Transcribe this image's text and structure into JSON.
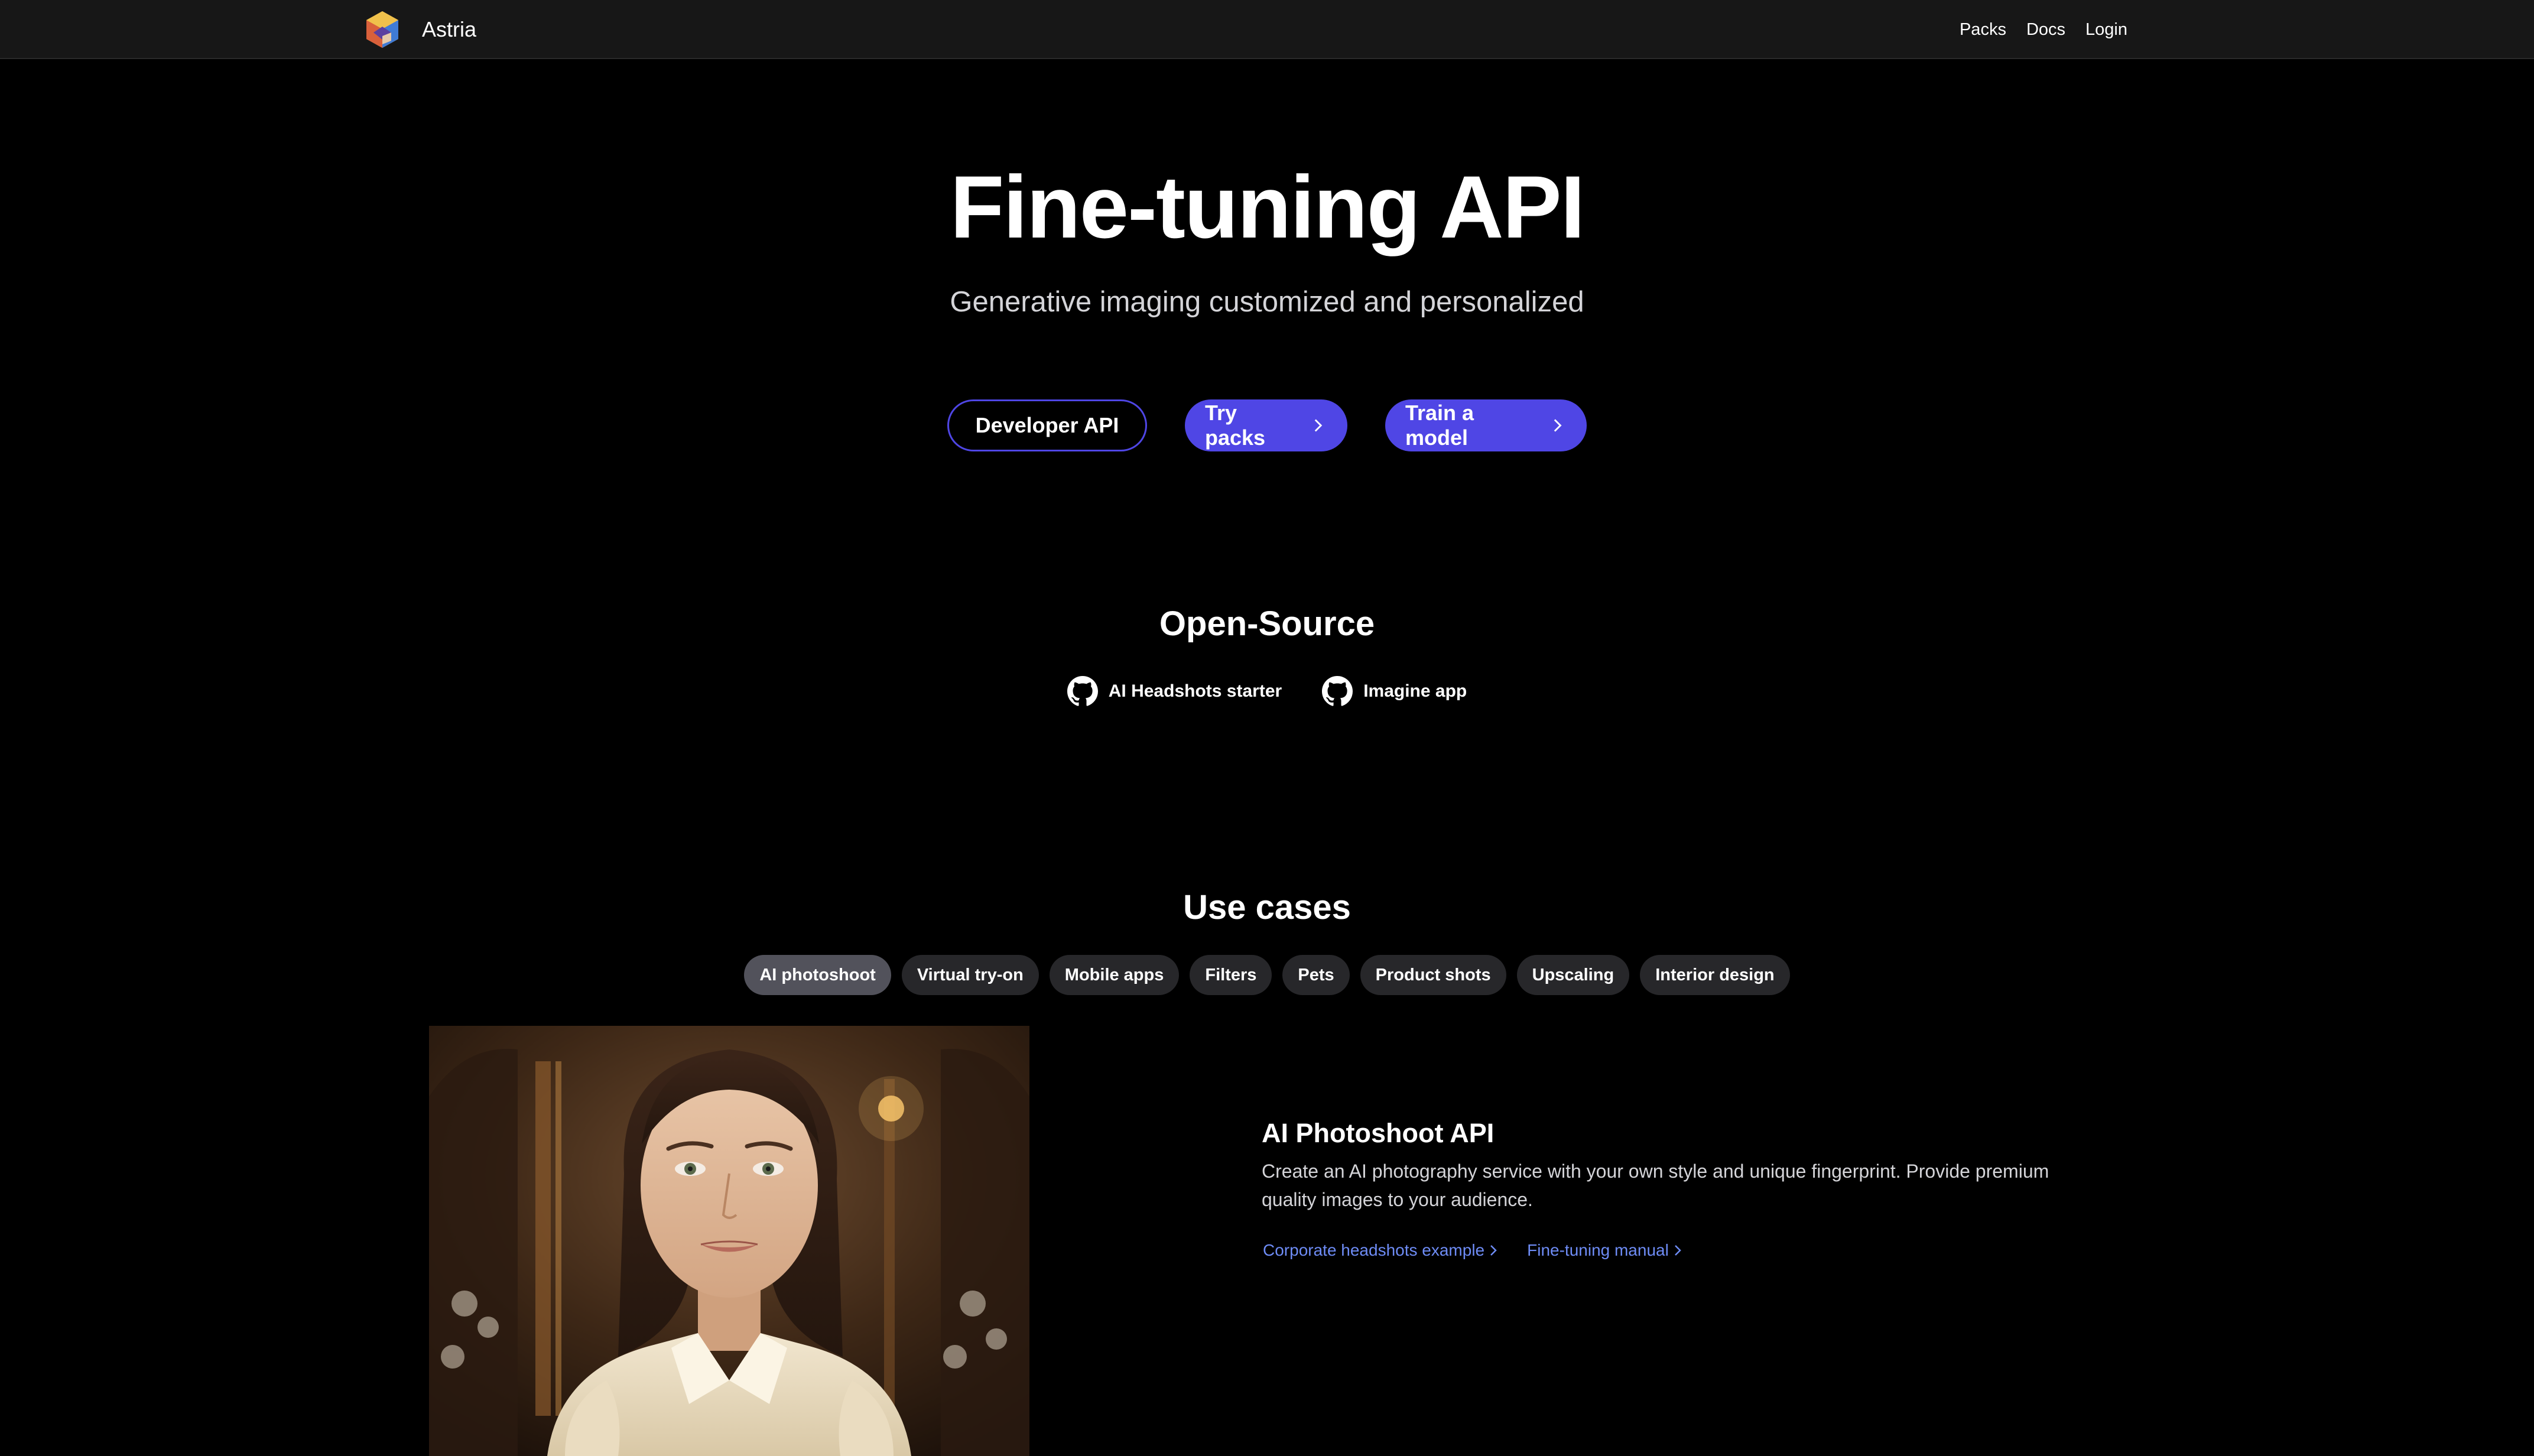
{
  "colors": {
    "accent": "#4f46e5",
    "link": "#6e8cf6",
    "navbar_bg": "#171717",
    "tab_bg": "#27272a",
    "tab_active_bg": "#52525b"
  },
  "navbar": {
    "brand": "Astria",
    "logo_icon": "astria-logo-icon",
    "links": [
      "Packs",
      "Docs",
      "Login"
    ]
  },
  "hero": {
    "title": "Fine-tuning API",
    "subtitle": "Generative imaging customized and personalized",
    "buttons": {
      "developer_api": "Developer API",
      "try_packs": "Try packs",
      "train_model": "Train a model"
    }
  },
  "open_source": {
    "title": "Open-Source",
    "links": [
      {
        "label": "AI Headshots starter",
        "icon": "github-icon"
      },
      {
        "label": "Imagine app",
        "icon": "github-icon"
      }
    ]
  },
  "use_cases": {
    "title": "Use cases",
    "tabs": [
      "AI photoshoot",
      "Virtual try-on",
      "Mobile apps",
      "Filters",
      "Pets",
      "Product shots",
      "Upscaling",
      "Interior design"
    ],
    "active_tab": "AI photoshoot",
    "active": {
      "heading": "AI Photoshoot API",
      "description": "Create an AI photography service with your own style and unique fingerprint. Provide premium quality images to your audience.",
      "links": [
        "Corporate headshots example",
        "Fine-tuning manual"
      ]
    }
  }
}
